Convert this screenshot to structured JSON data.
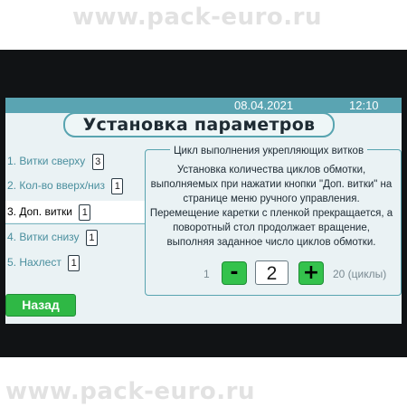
{
  "watermark": {
    "text": "www.pack-euro.ru"
  },
  "header": {
    "date": "08.04.2021",
    "time": "12:10"
  },
  "title": "Установка параметров",
  "parameters": [
    {
      "label": "1. Витки сверху",
      "value": "3"
    },
    {
      "label": "2. Кол-во вверх/низ",
      "value": "1"
    },
    {
      "label": "3. Доп. витки",
      "value": "1"
    },
    {
      "label": "4. Витки снизу",
      "value": "1"
    },
    {
      "label": "5. Нахлест",
      "value": "1"
    }
  ],
  "info": {
    "title": "Цикл выполнения укрепляющих витков",
    "description": "Установка количества циклов обмотки, выполняемых при нажатии кнопки \"Доп. витки\" на странице меню ручного управления. Перемещение каретки с пленкой прекращается, а поворотный стол продолжает вращение, выполняя заданное число циклов обмотки."
  },
  "stepper": {
    "min_label": "1",
    "max_label": "20 (циклы)",
    "value": "2",
    "minus_label": "-",
    "plus_label": "+"
  },
  "back_button": {
    "label": "Назад"
  },
  "colors": {
    "accent": "#58a4b0",
    "button_green": "#34c24c",
    "screen_bg": "#eaf2f4",
    "bezel": "#111315"
  }
}
